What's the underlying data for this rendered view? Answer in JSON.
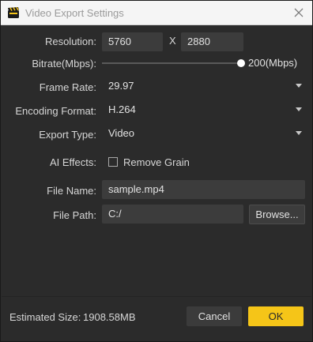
{
  "window": {
    "title": "Video Export Settings",
    "icon": "film-clapper-icon",
    "close_icon": "close-icon"
  },
  "form": {
    "resolution": {
      "label": "Resolution:",
      "width": "5760",
      "separator": "X",
      "height": "2880"
    },
    "bitrate": {
      "label": "Bitrate(Mbps):",
      "value_text": "200(Mbps)",
      "level": 1.0
    },
    "frame_rate": {
      "label": "Frame Rate:",
      "value": "29.97"
    },
    "encoding_format": {
      "label": "Encoding Format:",
      "value": "H.264"
    },
    "export_type": {
      "label": "Export Type:",
      "value": "Video"
    },
    "ai_effects": {
      "label": "AI Effects:",
      "option_label": "Remove Grain",
      "checked": false
    },
    "file_name": {
      "label": "File Name:",
      "value": "sample.mp4"
    },
    "file_path": {
      "label": "File Path:",
      "value": "C:/",
      "browse_label": "Browse..."
    }
  },
  "footer": {
    "estimated_size_label": "Estimated Size:",
    "estimated_size_value": "1908.58MB",
    "cancel_label": "Cancel",
    "ok_label": "OK"
  },
  "colors": {
    "accent": "#f5c518",
    "background": "#2b2b2b",
    "field": "#3c3c3c"
  }
}
